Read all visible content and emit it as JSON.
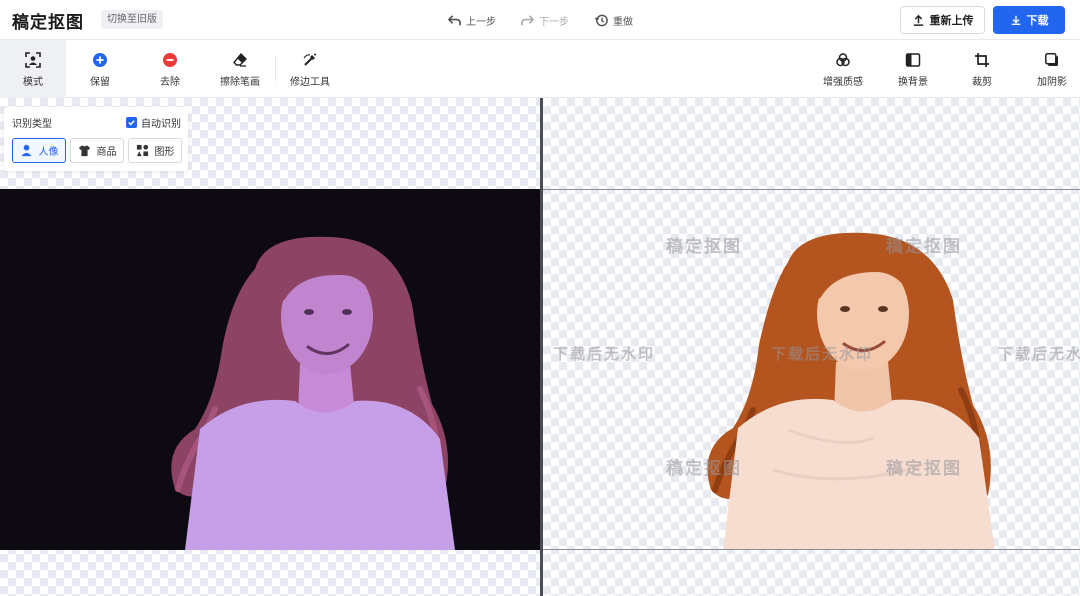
{
  "header": {
    "logo": "稿定抠图",
    "old_version": "切换至旧版",
    "undo": "上一步",
    "redo": "下一步",
    "redo_all": "重做",
    "reupload": "重新上传",
    "download": "下载"
  },
  "toolbar": {
    "left": [
      {
        "label": "模式",
        "icon": "mode-icon"
      },
      {
        "label": "保留",
        "icon": "plus-circle-icon"
      },
      {
        "label": "去除",
        "icon": "minus-circle-icon"
      },
      {
        "label": "擦除笔画",
        "icon": "eraser-icon"
      },
      {
        "label": "修边工具",
        "icon": "edge-brush-icon"
      }
    ],
    "right": [
      {
        "label": "增强质感",
        "icon": "enhance-icon"
      },
      {
        "label": "换背景",
        "icon": "background-icon"
      },
      {
        "label": "裁剪",
        "icon": "crop-icon"
      },
      {
        "label": "加阴影",
        "icon": "shadow-icon"
      }
    ]
  },
  "recognition": {
    "title": "识别类型",
    "auto_label": "自动识别",
    "auto_checked": true,
    "types": [
      {
        "label": "人像",
        "icon": "person-icon",
        "selected": true
      },
      {
        "label": "商品",
        "icon": "shirt-icon",
        "selected": false
      },
      {
        "label": "图形",
        "icon": "shapes-icon",
        "selected": false
      }
    ]
  },
  "preview": {
    "watermarks": [
      "稿定抠图",
      "稿定抠图",
      "下载后无水印",
      "下载后无水印",
      "下载后无水印",
      "稿定抠图",
      "稿定抠图"
    ]
  },
  "colors": {
    "accent": "#2266f0",
    "mask_overlay": "#b27fe0",
    "hair": "#b4541f"
  }
}
